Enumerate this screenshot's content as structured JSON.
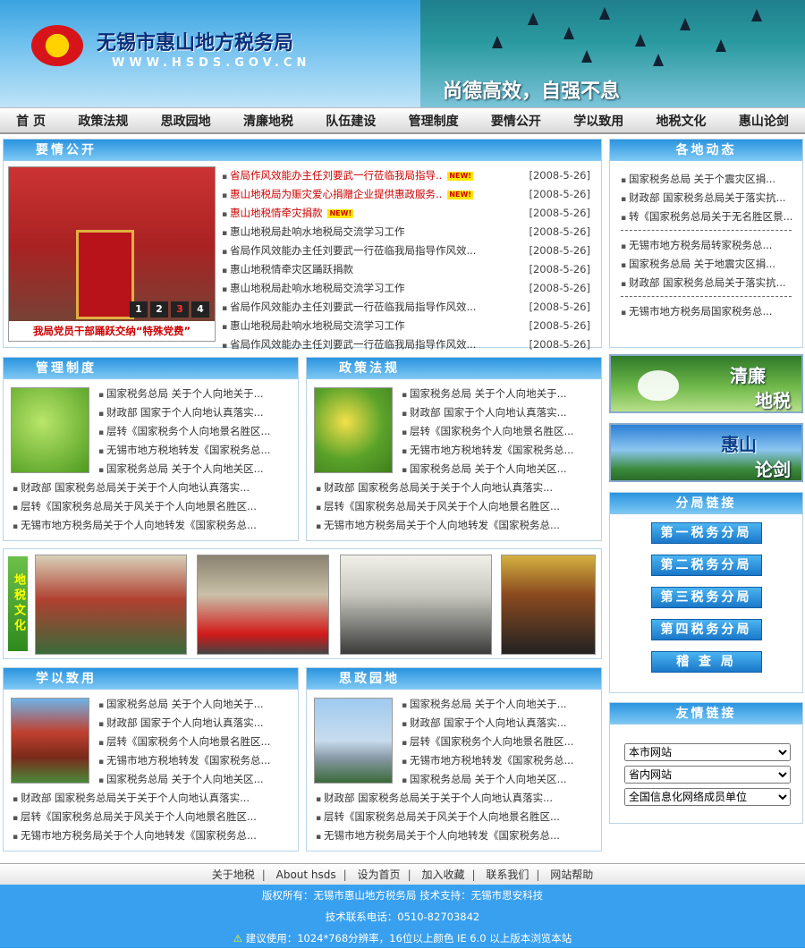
{
  "site": {
    "name": "无锡市惠山地方税务局",
    "url": "WWW.HSDS.GOV.CN",
    "motto": "尚德高效，自强不息"
  },
  "nav": [
    "首 页",
    "政策法规",
    "思政园地",
    "清廉地税",
    "队伍建设",
    "管理制度",
    "要情公开",
    "学以致用",
    "地税文化",
    "惠山论剑"
  ],
  "news": {
    "title": "要情公开",
    "photo_caption": "我局党员干部踊跃交纳“特殊党费”",
    "photo_pages": [
      "1",
      "2",
      "3",
      "4"
    ],
    "items": [
      {
        "text": "省局作风效能办主任刘要武一行莅临我局指导..",
        "date": "[2008-5-26]",
        "red": true,
        "new": "NEW!"
      },
      {
        "text": "惠山地税局为赈灾爱心捐赠企业提供惠政服务..",
        "date": "[2008-5-26]",
        "red": true,
        "new": "NEW!"
      },
      {
        "text": "惠山地税情牵灾捐款",
        "date": "[2008-5-26]",
        "red": true,
        "new": "NEW!"
      },
      {
        "text": "惠山地税局赴响水地税局交流学习工作",
        "date": "[2008-5-26]",
        "red": false,
        "new": ""
      },
      {
        "text": "省局作风效能办主任刘要武一行莅临我局指导作风效...",
        "date": "[2008-5-26]",
        "red": false,
        "new": ""
      },
      {
        "text": "惠山地税情牵灾区踊跃捐款",
        "date": "[2008-5-26]",
        "red": false,
        "new": ""
      },
      {
        "text": "惠山地税局赴响水地税局交流学习工作",
        "date": "[2008-5-26]",
        "red": false,
        "new": ""
      },
      {
        "text": "省局作风效能办主任刘要武一行莅临我局指导作风效...",
        "date": "[2008-5-26]",
        "red": false,
        "new": ""
      },
      {
        "text": "惠山地税局赴响水地税局交流学习工作",
        "date": "[2008-5-26]",
        "red": false,
        "new": ""
      },
      {
        "text": "省局作风效能办主任刘要武一行莅临我局指导作风效...",
        "date": "[2008-5-26]",
        "red": false,
        "new": ""
      }
    ]
  },
  "local": {
    "title": "各地动态",
    "group1": [
      "国家税务总局 关于个震灾区捐...",
      "财政部 国家税务总局关于落实抗...",
      "转《国家税务总局关于无名胜区景..."
    ],
    "group2": [
      "无锡市地方税务局转家税务总...",
      "国家税务总局 关于地震灾区捐...",
      "财政部 国家税务总局关于落实抗..."
    ],
    "group3": [
      "无锡市地方税务局国家税务总..."
    ]
  },
  "mgmt": {
    "title": "管理制度",
    "top": [
      "国家税务总局 关于个人向地关于...",
      "财政部 国家于个人向地认真落实...",
      "层转《国家税务个人向地景名胜区...",
      "无锡市地方税地转发《国家税务总...",
      "国家税务总局 关于个人向地关区..."
    ],
    "bottom": [
      "财政部 国家税务总局关于关于个人向地认真落实...",
      "层转《国家税务总局关于风关于个人向地景名胜区...",
      "无锡市地方税务局关于个人向地转发《国家税务总..."
    ]
  },
  "policy": {
    "title": "政策法规",
    "top": [
      "国家税务总局 关于个人向地关于...",
      "财政部 国家于个人向地认真落实...",
      "层转《国家税务个人向地景名胜区...",
      "无锡市地方税地转发《国家税务总...",
      "国家税务总局 关于个人向地关区..."
    ],
    "bottom": [
      "财政部 国家税务总局关于关于个人向地认真落实...",
      "层转《国家税务总局关于风关于个人向地景名胜区...",
      "无锡市地方税务局关于个人向地转发《国家税务总..."
    ]
  },
  "culture": {
    "label": "地税文化"
  },
  "study": {
    "title": "学以致用",
    "top": [
      "国家税务总局 关于个人向地关于...",
      "财政部 国家于个人向地认真落实...",
      "层转《国家税务个人向地景名胜区...",
      "无锡市地方税地转发《国家税务总...",
      "国家税务总局 关于个人向地关区..."
    ],
    "bottom": [
      "财政部 国家税务总局关于关于个人向地认真落实...",
      "层转《国家税务总局关于风关于个人向地景名胜区...",
      "无锡市地方税务局关于个人向地转发《国家税务总..."
    ]
  },
  "thought": {
    "title": "思政园地",
    "top": [
      "国家税务总局 关于个人向地关于...",
      "财政部 国家于个人向地认真落实...",
      "层转《国家税务个人向地景名胜区...",
      "无锡市地方税地转发《国家税务总...",
      "国家税务总局 关于个人向地关区..."
    ],
    "bottom": [
      "财政部 国家税务总局关于关于个人向地认真落实...",
      "层转《国家税务总局关于风关于个人向地景名胜区...",
      "无锡市地方税务局关于个人向地转发《国家税务总..."
    ]
  },
  "ads": {
    "clean": {
      "line1": "清廉",
      "line2": "地税"
    },
    "forum": {
      "line1": "惠山",
      "line2": "论剑"
    }
  },
  "branches": {
    "title": "分局链接",
    "items": [
      "第一税务分局",
      "第二税务分局",
      "第三税务分局",
      "第四税务分局",
      "稽 查 局"
    ]
  },
  "friends": {
    "title": "友情链接",
    "options": [
      "本市网站",
      "省内网站",
      "全国信息化网络成员单位"
    ]
  },
  "footer": {
    "links": [
      "关于地税",
      "About hsds",
      "设为首页",
      "加入收藏",
      "联系我们",
      "网站帮助"
    ],
    "copyright": "版权所有：无锡市惠山地方税务局  技术支持：无锡市思安科技",
    "phone": "技术联系电话：0510-82703842",
    "advice": "建议使用：1024*768分辨率，16位以上颜色 IE 6.0 以上版本浏览本站"
  },
  "colors": {
    "accent": "#39a0ef",
    "header_blue": "#2a94df",
    "red_text": "#cc0000"
  }
}
